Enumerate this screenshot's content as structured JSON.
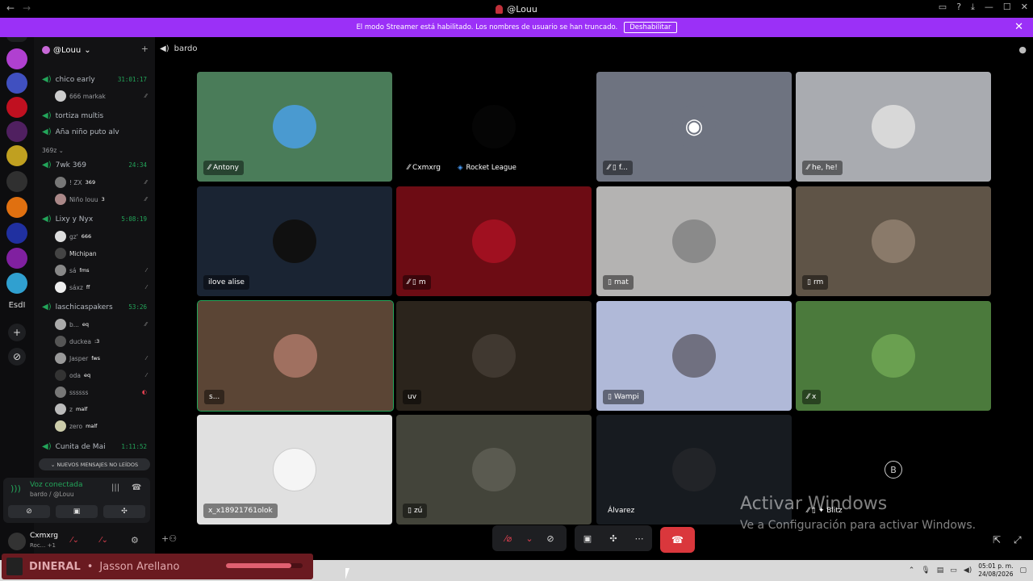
{
  "window": {
    "title": "@Louu",
    "nav_back": "←",
    "nav_fwd": "→",
    "controls": [
      "▭",
      "?",
      "⤓",
      "—",
      "☐",
      "✕"
    ]
  },
  "banner": {
    "text": "El modo Streamer está habilitado. Los nombres de usuario se han truncado.",
    "button": "Deshabilitar",
    "close": "✕"
  },
  "guilds": {
    "dm_icon": "discord-icon",
    "text_server": "EsdI",
    "add": "+",
    "explore": "⊘",
    "colors": [
      "#b040d0",
      "#4050c0",
      "#c01020",
      "#502060",
      "#c0a020",
      "#303030",
      "#e07010",
      "#2030a0",
      "#8020a0",
      "#30a0d0"
    ]
  },
  "server": {
    "name": "@Louu",
    "chevron": "⌄",
    "add_member": "+"
  },
  "channels": [
    {
      "name": "chico early",
      "time": "31:01:17",
      "members": [
        {
          "name": "666 markak",
          "icons": "⁄⁄"
        }
      ]
    },
    {
      "name": "tortiza multis",
      "time": "",
      "members": []
    },
    {
      "name": "Aña niño puto alv",
      "time": "",
      "members": []
    }
  ],
  "category": "369z ⌄",
  "channels2": [
    {
      "name": "7wk 369",
      "time": "24:34",
      "members": [
        {
          "name": "! ZX",
          "badge": "369",
          "icons": "⁄⁄"
        },
        {
          "name": "Niño louu",
          "badge": "3",
          "icons": "⁄⁄"
        }
      ]
    },
    {
      "name": "Lixy y Nyx",
      "time": "5:08:19",
      "members": [
        {
          "name": "gz'",
          "badge": "666",
          "icons": ""
        },
        {
          "name": "Michipan",
          "badge": "",
          "icons": ""
        },
        {
          "name": "sá",
          "badge": "fms",
          "icons": "⁄"
        },
        {
          "name": "sáxz",
          "badge": "ff",
          "icons": "⁄"
        }
      ]
    },
    {
      "name": "laschicaspakers",
      "time": "53:26",
      "members": [
        {
          "name": "b...",
          "badge": "eq",
          "icons": "⁄⁄"
        },
        {
          "name": "duckea",
          "badge": ":3",
          "icons": ""
        },
        {
          "name": "Jasper",
          "badge": "fws",
          "icons": "⁄"
        },
        {
          "name": "oda",
          "badge": "eq",
          "icons": "⁄"
        },
        {
          "name": "ssssss",
          "badge": "",
          "icons": "◐"
        },
        {
          "name": "z",
          "badge": "malf",
          "icons": ""
        },
        {
          "name": "zero",
          "badge": "malf",
          "icons": ""
        }
      ]
    },
    {
      "name": "Cunita de Mai",
      "time": "1:11:52",
      "members": []
    }
  ],
  "new_messages": "⌄ NUEVOS MENSAJES NO LEÍDOS",
  "voice": {
    "status": "Voz conectada",
    "channel": "bardo / @Louu"
  },
  "user": {
    "name": "Cxmxrg",
    "sub": "Roc... +1"
  },
  "main": {
    "channel": "bardo"
  },
  "tiles": [
    {
      "name": "Antony",
      "bg": "#4a7c59",
      "av": "#4a9ad0",
      "lbl_icon": "⁄⁄"
    },
    {
      "name": "Cxmxrg",
      "bg": "#000000",
      "av": "#050505",
      "lbl_icon": "⁄⁄",
      "game": "Rocket League"
    },
    {
      "name": "f...",
      "bg": "#6e7380",
      "av": "#5865f2",
      "lbl_icon": "⁄⁄ ▯"
    },
    {
      "name": "he, he!",
      "bg": "#a9abb0",
      "av": "#d8d8d8",
      "lbl_icon": "⁄⁄"
    },
    {
      "name": "ilove alise",
      "bg": "#1a2433",
      "av": "#101010",
      "lbl_icon": ""
    },
    {
      "name": "m",
      "bg": "#6d0c14",
      "av": "#a01020",
      "lbl_icon": "⁄⁄ ▯"
    },
    {
      "name": "mat",
      "bg": "#b4b3b2",
      "av": "#8a8a8a",
      "lbl_icon": "▯"
    },
    {
      "name": "rm",
      "bg": "#5f5447",
      "av": "#8a7a6a",
      "lbl_icon": "▯"
    },
    {
      "name": "s...",
      "bg": "#5b4535",
      "av": "#a07060",
      "lbl_icon": ""
    },
    {
      "name": "uv",
      "bg": "#2b241c",
      "av": "#403830",
      "lbl_icon": ""
    },
    {
      "name": "Wampi",
      "bg": "#b0b9d8",
      "av": "#707080",
      "lbl_icon": "▯"
    },
    {
      "name": "x",
      "bg": "#4b7a3c",
      "av": "#6aa050",
      "lbl_icon": "⁄⁄"
    },
    {
      "name": "x_x18921761olok",
      "bg": "#e0e0e0",
      "av": "#f5f5f5",
      "lbl_icon": ""
    },
    {
      "name": "zú",
      "bg": "#43443a",
      "av": "#5a5a50",
      "lbl_icon": "▯"
    },
    {
      "name": "Álvarez",
      "bg": "#171b20",
      "av": "#222428",
      "lbl_icon": ""
    },
    {
      "name": "✦ Blitz",
      "bg": "#000000",
      "av": "#000000",
      "lbl_icon": "⁄⁄ ▯"
    }
  ],
  "watermark": {
    "line1": "Activar Windows",
    "line2": "Ve a Configuración para activar Windows."
  },
  "music": {
    "song": "DINERAL",
    "sep": "•",
    "artist": "Jasson Arellano",
    "progress": 0.85
  },
  "clock": {
    "time": "05:01 p. m.",
    "date": "24/08/2026"
  }
}
